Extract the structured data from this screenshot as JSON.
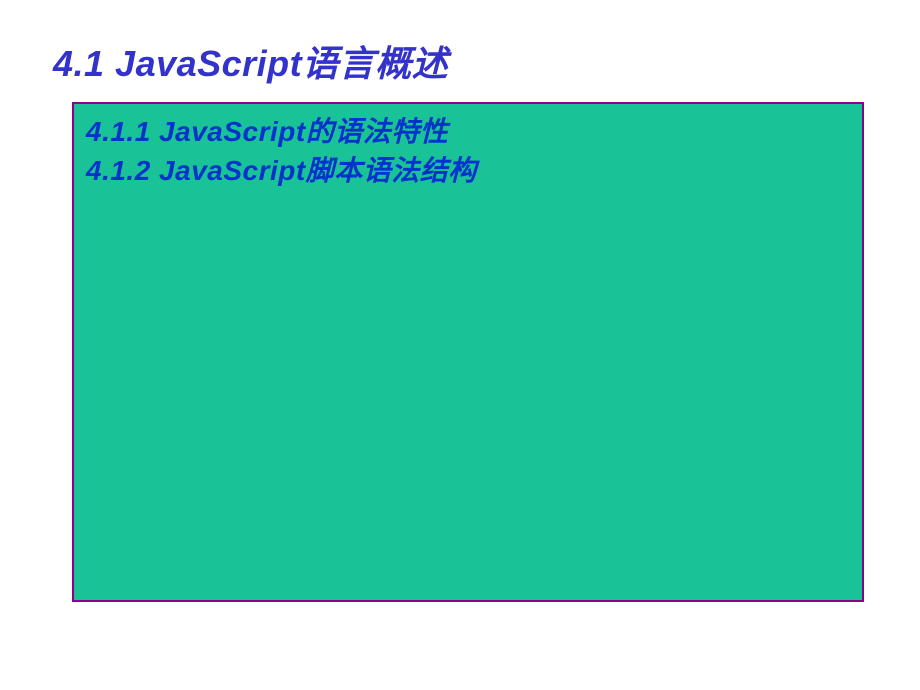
{
  "title": "4.1  JavaScript语言概述",
  "subitems": [
    "4.1.1  JavaScript的语法特性",
    "4.1.2  JavaScript脚本语法结构"
  ]
}
